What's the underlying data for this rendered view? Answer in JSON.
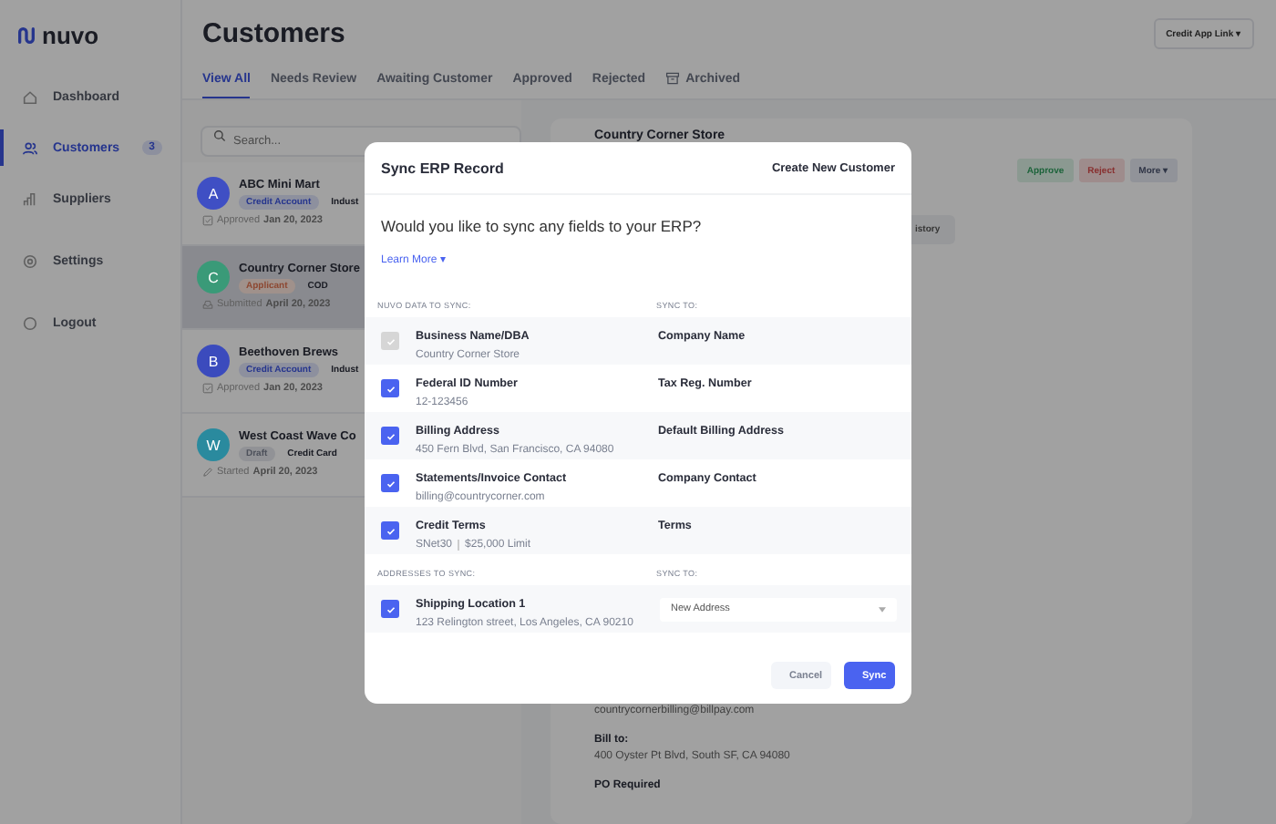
{
  "sidebar": {
    "logo": "nuvo",
    "items": [
      {
        "label": "Dashboard",
        "selected": false
      },
      {
        "label": "Customers",
        "selected": true,
        "badge": "3"
      },
      {
        "label": "Suppliers",
        "selected": false
      },
      {
        "label": "Settings",
        "selected": false
      },
      {
        "label": "Logout",
        "selected": false
      }
    ]
  },
  "header": {
    "title": "Customers",
    "action": "Credit App Link ▾"
  },
  "tabs": [
    {
      "label": "View All",
      "selected": true
    },
    {
      "label": "Needs Review",
      "selected": false
    },
    {
      "label": "Awaiting Customer",
      "selected": false
    },
    {
      "label": "Approved",
      "selected": false
    },
    {
      "label": "Rejected",
      "selected": false
    },
    {
      "label": "Archived",
      "selected": false
    }
  ],
  "search": {
    "placeholder": "Search..."
  },
  "customers": [
    {
      "initial": "A",
      "name": "ABC Mini Mart",
      "color": "#3f4fc4",
      "tag": "Credit Account",
      "kind": "approved",
      "extra": "Indust",
      "status": "Approved",
      "date": "Jan 20, 2023",
      "selected": false
    },
    {
      "initial": "C",
      "name": "Country Corner Store",
      "color": "#3a9a78",
      "tag": "Applicant",
      "kind": "submitted",
      "extra": "COD",
      "status": "Submitted",
      "date": "April 20, 2023",
      "selected": true
    },
    {
      "initial": "B",
      "name": "Beethoven Brews",
      "color": "#3b4bbd",
      "tag": "Credit Account",
      "kind": "approved",
      "extra": "Indust",
      "status": "Approved",
      "date": "Jan 20, 2023",
      "selected": false
    },
    {
      "initial": "W",
      "name": "West Coast Wave Co",
      "color": "#2a8a9e",
      "tag": "Draft",
      "kind": "started",
      "extra": "Credit Card",
      "status": "Started",
      "date": "April 20, 2023",
      "selected": false
    }
  ],
  "detail": {
    "title": "Country Corner Store",
    "buttons": [
      {
        "label": "Approve",
        "kind": "approve"
      },
      {
        "label": "Reject",
        "kind": "reject"
      },
      {
        "label": "More ▾",
        "kind": "more"
      }
    ],
    "tab": "istory",
    "email": "countrycornerbilling@billpay.com",
    "bill_to_label": "Bill to:",
    "bill_to": "400 Oyster Pt Blvd, South SF, CA 94080",
    "po": "PO Required"
  },
  "modal": {
    "title": "Sync ERP Record",
    "create_link": "Create New Customer",
    "question": "Would you like to sync any fields to your ERP?",
    "learn_more": "Learn More ▾",
    "fields_header": "NUVO DATA TO SYNC:",
    "sync_header": "SYNC TO:",
    "fields": [
      {
        "label": "Business Name/DBA",
        "values": [
          "Country Corner Store"
        ],
        "target": "Company Name",
        "checked": true,
        "disabled": true
      },
      {
        "label": "Federal ID Number",
        "values": [
          "12-123456"
        ],
        "target": "Tax Reg. Number",
        "checked": true,
        "disabled": false
      },
      {
        "label": "Billing Address",
        "values": [
          "450 Fern Blvd, San Francisco, CA 94080"
        ],
        "target": "Default Billing Address",
        "checked": true,
        "disabled": false
      },
      {
        "label": "Statements/Invoice Contact",
        "values": [
          "billing@countrycorner.com"
        ],
        "target": "Company Contact",
        "checked": true,
        "disabled": false
      },
      {
        "label": "Credit Terms",
        "values": [
          "SNet30",
          "$25,000 Limit"
        ],
        "target": "Terms",
        "checked": true,
        "disabled": false
      }
    ],
    "addresses_header": "ADDRESSES TO SYNC:",
    "address_sync_header": "SYNC TO:",
    "addresses": [
      {
        "label": "Shipping Location 1",
        "value": "123 Relington street, Los Angeles, CA 90210",
        "target": "New Address",
        "checked": true,
        "disabled": false
      }
    ],
    "buttons": [
      {
        "label": "Cancel",
        "kind": "secondary"
      },
      {
        "label": "Sync",
        "kind": "primary"
      }
    ]
  }
}
